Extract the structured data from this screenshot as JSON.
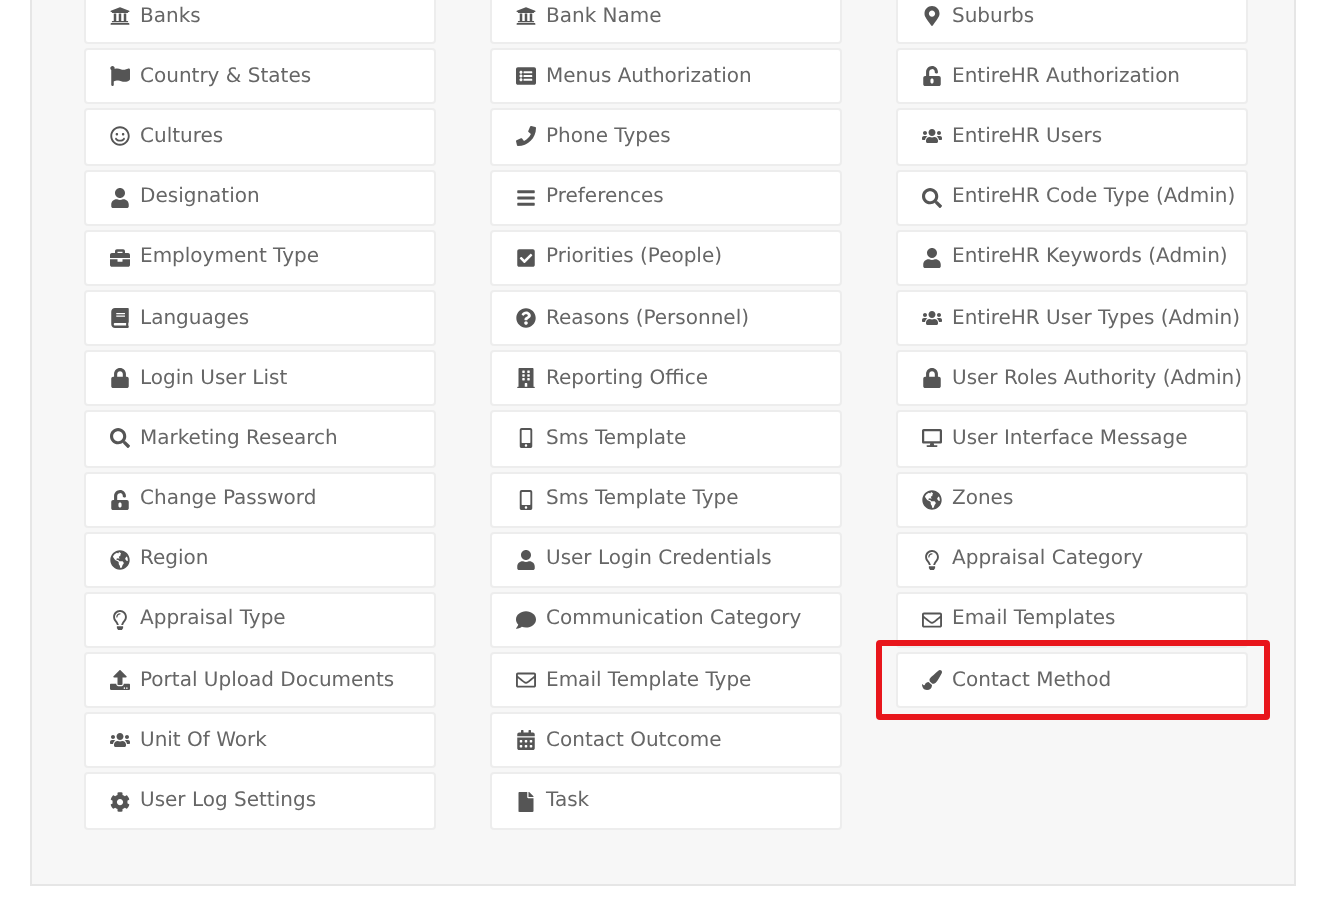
{
  "columns": [
    {
      "items": [
        {
          "label": "Banks",
          "highlighted": false
        },
        {
          "label": "Country & States",
          "highlighted": false
        },
        {
          "label": "Cultures",
          "highlighted": false
        },
        {
          "label": "Designation",
          "highlighted": false
        },
        {
          "label": "Employment Type",
          "highlighted": false
        },
        {
          "label": "Languages",
          "highlighted": false
        },
        {
          "label": "Login User List",
          "highlighted": false
        },
        {
          "label": "Marketing Research",
          "highlighted": false
        },
        {
          "label": "Change Password",
          "highlighted": false
        },
        {
          "label": "Region",
          "highlighted": false
        },
        {
          "label": "Appraisal Type",
          "highlighted": false
        },
        {
          "label": "Portal Upload Documents",
          "highlighted": false
        },
        {
          "label": "Unit Of Work",
          "highlighted": false
        },
        {
          "label": "User Log Settings",
          "highlighted": false
        }
      ]
    },
    {
      "items": [
        {
          "label": "Bank Name",
          "highlighted": false
        },
        {
          "label": "Menus Authorization",
          "highlighted": false
        },
        {
          "label": "Phone Types",
          "highlighted": false
        },
        {
          "label": "Preferences",
          "highlighted": false
        },
        {
          "label": "Priorities (People)",
          "highlighted": false
        },
        {
          "label": "Reasons (Personnel)",
          "highlighted": false
        },
        {
          "label": "Reporting Office",
          "highlighted": false
        },
        {
          "label": "Sms Template",
          "highlighted": false
        },
        {
          "label": "Sms Template Type",
          "highlighted": false
        },
        {
          "label": "User Login Credentials",
          "highlighted": false
        },
        {
          "label": "Communication Category",
          "highlighted": false
        },
        {
          "label": "Email Template Type",
          "highlighted": false
        },
        {
          "label": "Contact Outcome",
          "highlighted": false
        },
        {
          "label": "Task",
          "highlighted": false
        }
      ]
    },
    {
      "items": [
        {
          "label": "Suburbs",
          "highlighted": false
        },
        {
          "label": "EntireHR Authorization",
          "highlighted": false
        },
        {
          "label": "EntireHR Users",
          "highlighted": false
        },
        {
          "label": "EntireHR Code Type (Admin)",
          "highlighted": false
        },
        {
          "label": "EntireHR Keywords (Admin)",
          "highlighted": false
        },
        {
          "label": "EntireHR User Types (Admin)",
          "highlighted": false
        },
        {
          "label": "User Roles Authority (Admin)",
          "highlighted": false
        },
        {
          "label": "User Interface Message",
          "highlighted": false
        },
        {
          "label": "Zones",
          "highlighted": false
        },
        {
          "label": "Appraisal Category",
          "highlighted": false
        },
        {
          "label": "Email Templates",
          "highlighted": false
        },
        {
          "label": "Contact Method",
          "highlighted": true
        }
      ]
    }
  ]
}
